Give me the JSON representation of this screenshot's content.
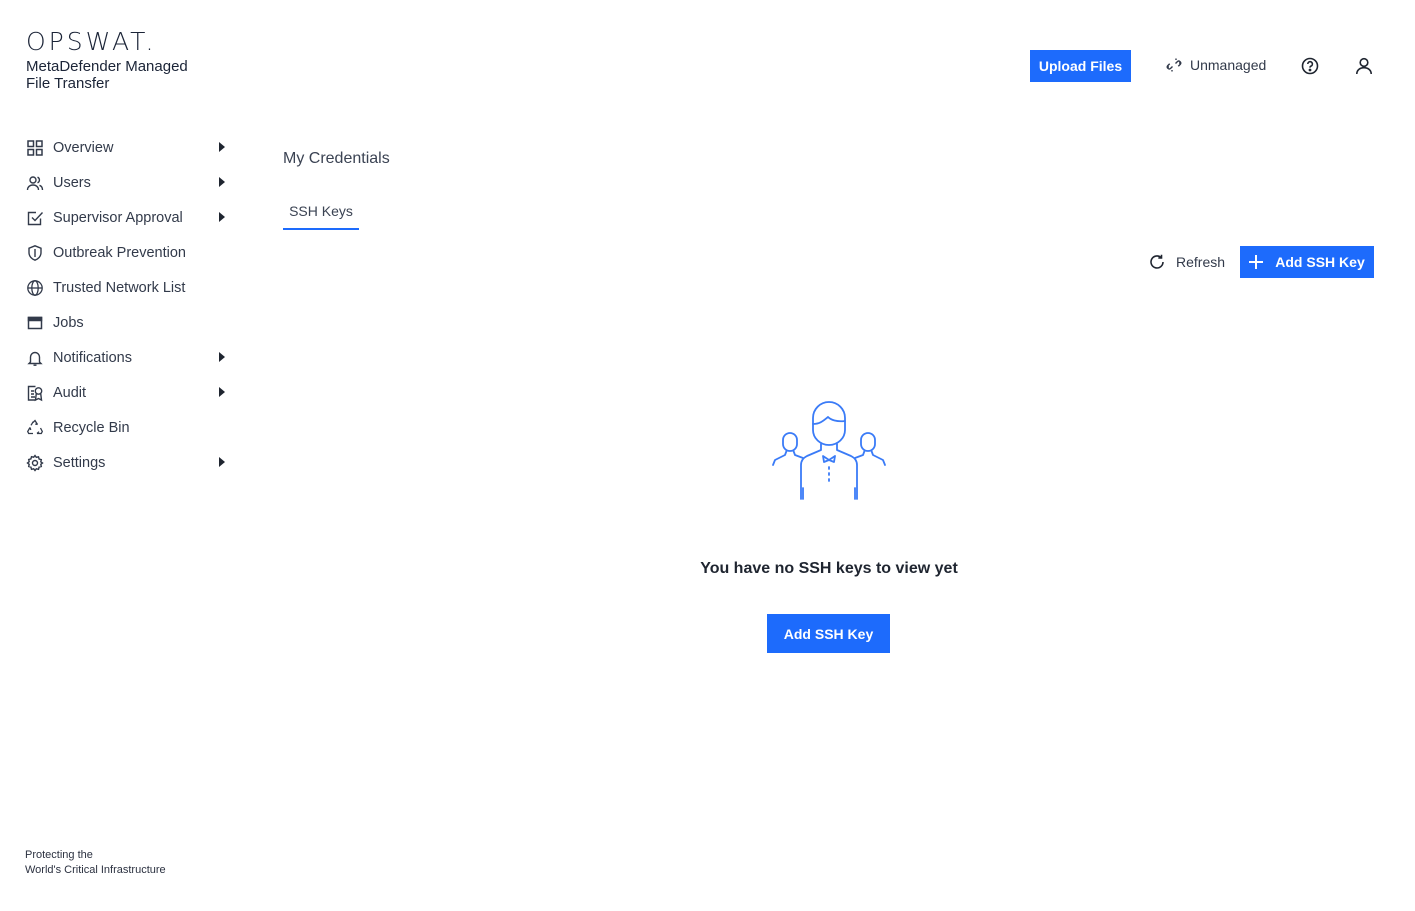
{
  "brand": {
    "logo": "OPSWAT.",
    "product": "MetaDefender Managed File Transfer",
    "tagline_line1": "Protecting the",
    "tagline_line2": "World's Critical Infrastructure"
  },
  "sidebar": {
    "items": [
      {
        "label": "Overview",
        "icon": "grid-icon",
        "has_submenu": true
      },
      {
        "label": "Users",
        "icon": "users-icon",
        "has_submenu": true
      },
      {
        "label": "Supervisor Approval",
        "icon": "check-square-icon",
        "has_submenu": true
      },
      {
        "label": "Outbreak Prevention",
        "icon": "shield-icon",
        "has_submenu": false
      },
      {
        "label": "Trusted Network List",
        "icon": "globe-icon",
        "has_submenu": false
      },
      {
        "label": "Jobs",
        "icon": "window-icon",
        "has_submenu": false
      },
      {
        "label": "Notifications",
        "icon": "bell-icon",
        "has_submenu": true
      },
      {
        "label": "Audit",
        "icon": "audit-icon",
        "has_submenu": true
      },
      {
        "label": "Recycle Bin",
        "icon": "recycle-icon",
        "has_submenu": false
      },
      {
        "label": "Settings",
        "icon": "gear-icon",
        "has_submenu": true
      }
    ]
  },
  "header": {
    "upload_label": "Upload Files",
    "status_label": "Unmanaged",
    "help_icon": "help-circle-icon",
    "user_icon": "user-icon"
  },
  "main": {
    "title": "My Credentials",
    "tabs": [
      {
        "label": "SSH Keys",
        "active": true
      }
    ],
    "refresh_label": "Refresh",
    "add_key_label": "Add SSH Key",
    "empty_message": "You have no SSH keys to view yet",
    "empty_button_label": "Add SSH Key"
  },
  "colors": {
    "accent": "#1d6bfc",
    "text": "#323a4a",
    "illustration": "#3a7bf7"
  }
}
